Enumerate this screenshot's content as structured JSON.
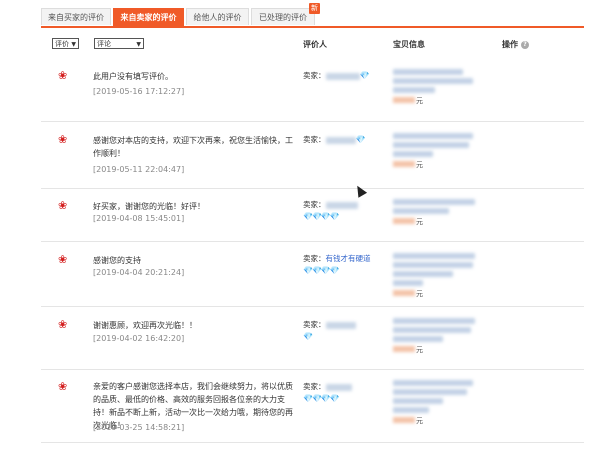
{
  "tabs": [
    {
      "label": "来自买家的评价",
      "active": false
    },
    {
      "label": "来自卖家的评价",
      "active": true
    },
    {
      "label": "给他人的评价",
      "active": false
    },
    {
      "label": "已处理的评价",
      "active": false,
      "badge": "新"
    }
  ],
  "header": {
    "filter_rating": "评价",
    "filter_comment": "评论",
    "col_reviewer": "评价人",
    "col_item": "宝贝信息",
    "col_action": "操作"
  },
  "rows": [
    {
      "comment": "此用户没有填写评价。",
      "date": "[2019-05-16 17:12:27]",
      "seller_label": "卖家：",
      "diamonds": "",
      "price_suffix": "元"
    },
    {
      "comment": "感谢您对本店的支持，欢迎下次再来，祝您生活愉快，工作顺利！",
      "date": "[2019-05-11 22:04:47]",
      "seller_label": "卖家：",
      "diamonds": "",
      "price_suffix": "元"
    },
    {
      "comment": "好买家，谢谢您的光临！好评！",
      "date": "[2019-04-08 15:45:01]",
      "seller_label": "卖家：",
      "diamonds": "💎💎💎💎",
      "price_suffix": "元"
    },
    {
      "comment": "感谢您的支持",
      "date": "[2019-04-04 20:21:24]",
      "seller_label": "卖家：",
      "seller_name": "有钱才有硬道",
      "diamonds": "💎💎💎💎",
      "price_suffix": "元"
    },
    {
      "comment": "谢谢惠顾，欢迎再次光临！！",
      "date": "[2019-04-02 16:42:20]",
      "seller_label": "卖家：",
      "diamonds": "",
      "price_suffix": "元"
    },
    {
      "comment": "亲爱的客户感谢您选择本店，我们会继续努力，将以优质的品质、最低的价格、高效的服务回报各位亲的大力支持！新品不断上新，活动一次比一次给力哦，期待您的再次光临！",
      "date": "[2019-03-25 14:58:21]",
      "seller_label": "卖家：",
      "diamonds": "💎💎💎💎",
      "price_suffix": "元"
    }
  ],
  "icons": {
    "flower": "flower-icon",
    "help": "question-circle-icon"
  },
  "colors": {
    "accent": "#f05a28",
    "link": "#3366cc",
    "diamond": "#2f8fe0"
  }
}
